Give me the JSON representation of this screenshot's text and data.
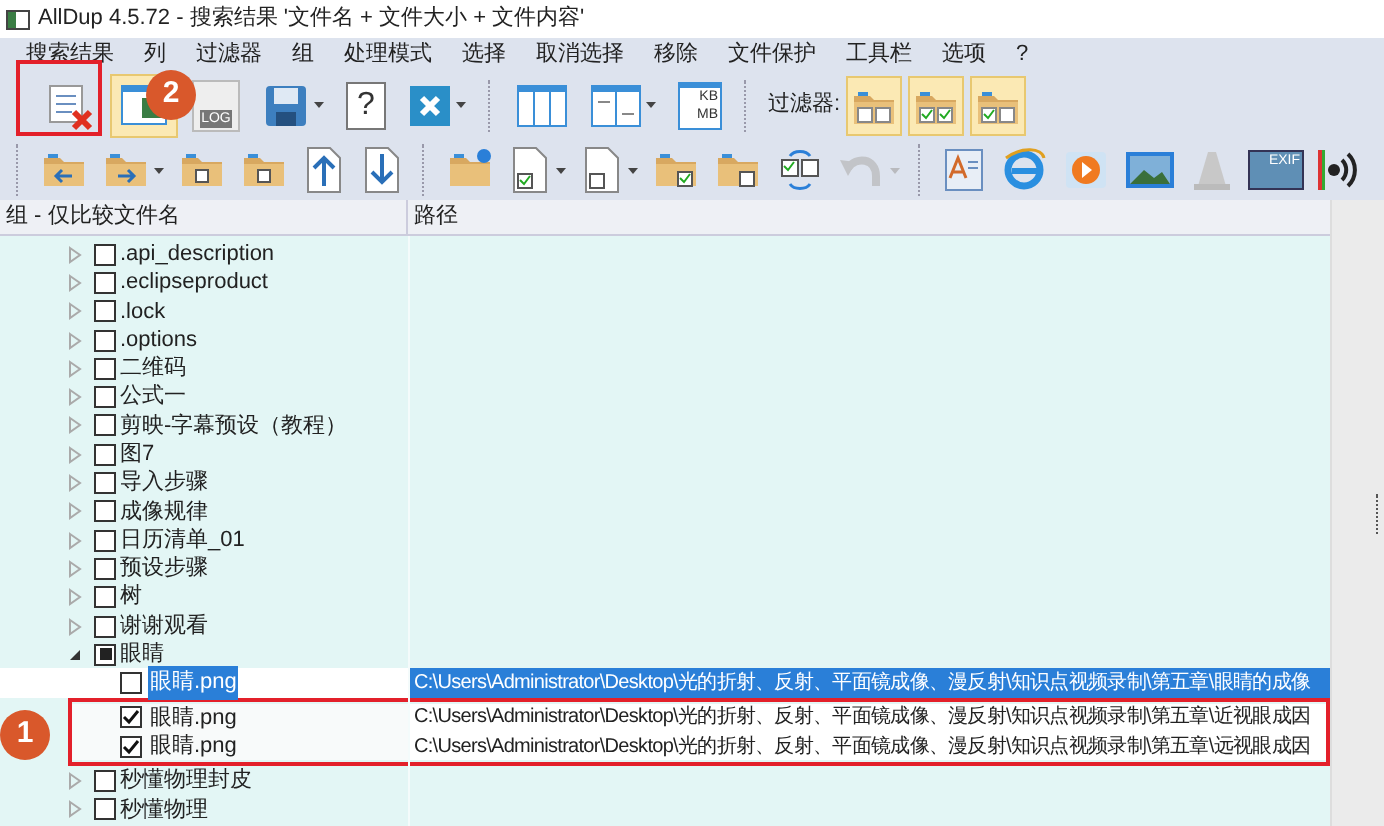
{
  "window": {
    "title": "AllDup 4.5.72 - 搜索结果 '文件名 + 文件大小 + 文件内容'"
  },
  "menu": [
    "搜索结果",
    "列",
    "过滤器",
    "组",
    "处理模式",
    "选择",
    "取消选择",
    "移除",
    "文件保护",
    "工具栏",
    "选项",
    "?"
  ],
  "toolbar_1": [
    {
      "kind": "list-remove",
      "selected": false,
      "caret": false
    },
    {
      "kind": "preview",
      "selected": true,
      "caret": false
    },
    {
      "kind": "log",
      "selected": false,
      "caret": false,
      "label": "LOG"
    },
    {
      "kind": "save",
      "selected": false,
      "caret": true
    },
    {
      "kind": "help",
      "selected": false,
      "caret": false,
      "label": "?"
    },
    {
      "kind": "close",
      "selected": false,
      "caret": true
    },
    {
      "kind": "grip"
    },
    {
      "kind": "columns",
      "selected": false,
      "caret": false
    },
    {
      "kind": "columns2",
      "selected": false,
      "caret": true
    },
    {
      "kind": "size",
      "selected": false,
      "caret": false,
      "label": "KB",
      "label2": "MB"
    },
    {
      "kind": "grip"
    }
  ],
  "filter": {
    "label": "过滤器:",
    "buttons": [
      {
        "kind": "none",
        "selected": true
      },
      {
        "kind": "both",
        "selected": true
      },
      {
        "kind": "first",
        "selected": true
      }
    ]
  },
  "toolbar_2": [
    {
      "kind": "folder-back",
      "caret": false,
      "disabled": false
    },
    {
      "kind": "folder-forward",
      "caret": true,
      "disabled": false
    },
    {
      "kind": "folder-up",
      "caret": false,
      "disabled": false
    },
    {
      "kind": "folder-down",
      "caret": false,
      "disabled": false
    },
    {
      "kind": "arrow-up",
      "caret": false,
      "disabled": false
    },
    {
      "kind": "arrow-down",
      "caret": false,
      "disabled": false
    },
    {
      "kind": "grip"
    },
    {
      "kind": "folder-gear",
      "caret": false,
      "disabled": false
    },
    {
      "kind": "doc-check",
      "caret": true,
      "disabled": false
    },
    {
      "kind": "doc-empty",
      "caret": true,
      "disabled": false
    },
    {
      "kind": "folder-check",
      "caret": false,
      "disabled": false
    },
    {
      "kind": "folder-empty",
      "caret": false,
      "disabled": false
    },
    {
      "kind": "swap",
      "caret": false,
      "disabled": false
    },
    {
      "kind": "undo",
      "caret": true,
      "disabled": true
    },
    {
      "kind": "grip"
    },
    {
      "kind": "document",
      "caret": false,
      "disabled": false
    },
    {
      "kind": "browser",
      "caret": false,
      "disabled": false
    },
    {
      "kind": "play",
      "caret": false,
      "disabled": false
    },
    {
      "kind": "picture",
      "caret": false,
      "disabled": false
    },
    {
      "kind": "cone",
      "caret": false,
      "disabled": false
    },
    {
      "kind": "exif",
      "caret": false,
      "disabled": false,
      "label": "EXIF"
    },
    {
      "kind": "sound",
      "caret": false,
      "disabled": false
    }
  ],
  "table": {
    "columns": [
      "组 - 仅比较文件名",
      "路径"
    ],
    "rows": [
      {
        "name": ".api_description",
        "checked": false,
        "indeterminate": false,
        "expanded": false
      },
      {
        "name": ".eclipseproduct",
        "checked": false,
        "indeterminate": false,
        "expanded": false
      },
      {
        "name": ".lock",
        "checked": false,
        "indeterminate": false,
        "expanded": false
      },
      {
        "name": ".options",
        "checked": false,
        "indeterminate": false,
        "expanded": false
      },
      {
        "name": "二维码",
        "checked": false,
        "indeterminate": false,
        "expanded": false
      },
      {
        "name": "公式一",
        "checked": false,
        "indeterminate": false,
        "expanded": false
      },
      {
        "name": "剪映-字幕预设（教程）",
        "checked": false,
        "indeterminate": false,
        "expanded": false
      },
      {
        "name": "图7",
        "checked": false,
        "indeterminate": false,
        "expanded": false
      },
      {
        "name": "导入步骤",
        "checked": false,
        "indeterminate": false,
        "expanded": false
      },
      {
        "name": "成像规律",
        "checked": false,
        "indeterminate": false,
        "expanded": false
      },
      {
        "name": "日历清单_01",
        "checked": false,
        "indeterminate": false,
        "expanded": false
      },
      {
        "name": "预设步骤",
        "checked": false,
        "indeterminate": false,
        "expanded": false
      },
      {
        "name": "树",
        "checked": false,
        "indeterminate": false,
        "expanded": false
      },
      {
        "name": "谢谢观看",
        "checked": false,
        "indeterminate": false,
        "expanded": false
      },
      {
        "name": "眼睛",
        "checked": false,
        "indeterminate": true,
        "expanded": true,
        "children": [
          {
            "name": "眼睛.png",
            "checked": false,
            "selected": true,
            "framed": false,
            "path": "C:\\Users\\Administrator\\Desktop\\光的折射、反射、平面镜成像、漫反射\\知识点视频录制\\第五章\\眼睛的成像"
          },
          {
            "name": "眼睛.png",
            "checked": true,
            "selected": false,
            "framed": true,
            "path": "C:\\Users\\Administrator\\Desktop\\光的折射、反射、平面镜成像、漫反射\\知识点视频录制\\第五章\\近视眼成因"
          },
          {
            "name": "眼睛.png",
            "checked": true,
            "selected": false,
            "framed": true,
            "path": "C:\\Users\\Administrator\\Desktop\\光的折射、反射、平面镜成像、漫反射\\知识点视频录制\\第五章\\远视眼成因"
          }
        ]
      },
      {
        "name": "秒懂物理封皮",
        "checked": false,
        "indeterminate": false,
        "expanded": false
      },
      {
        "name": "秒懂物理",
        "checked": false,
        "indeterminate": false,
        "expanded": false
      }
    ]
  },
  "callouts": [
    "1",
    "2"
  ]
}
